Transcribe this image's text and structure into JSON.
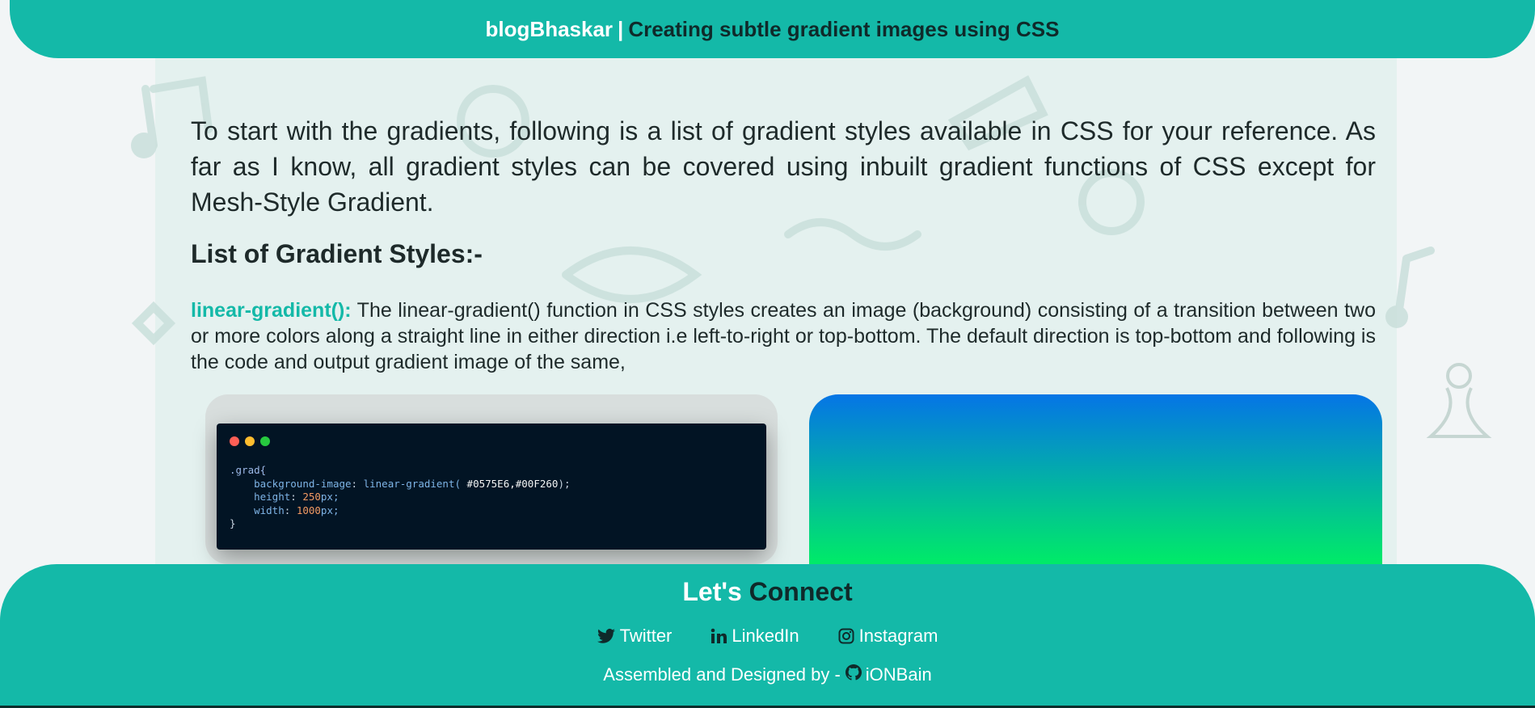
{
  "header": {
    "brand": "blogBhaskar",
    "separator": "|",
    "title": "Creating subtle gradient images using CSS"
  },
  "article": {
    "intro": "To start with the gradients, following is a list of gradient styles available in CSS for your reference. As far as I know, all gradient styles can be covered using inbuilt gradient functions of CSS except for Mesh-Style Gradient.",
    "section_heading": "List of Gradient Styles:-",
    "linear": {
      "term": "linear-gradient():",
      "description": " The linear-gradient() function in CSS styles creates an image (background) consisting of a transition between two or more colors along a straight line in either direction i.e left-to-right or top-bottom. The default direction is top-bottom and following is the code and output gradient image of the same,"
    }
  },
  "code_snippet": {
    "window_dot_colors": [
      "#ff5f56",
      "#ffbd2e",
      "#27c93f"
    ],
    "line1_selector": ".grad{",
    "line2_prop": "background-image",
    "line2_fn": "linear-gradient(",
    "line2_args": " #0575E6,#00F260",
    "line2_end": ");",
    "line3_prop": "height",
    "line3_num": "250",
    "line3_unit": "px;",
    "line4_prop": "width",
    "line4_num": "1000",
    "line4_unit": "px;",
    "line5_close": "}"
  },
  "gradient_output": {
    "from_color": "#0575E6",
    "to_color": "#00F260"
  },
  "footer": {
    "title_word1": "Let's",
    "title_word2": "Connect",
    "links": [
      {
        "label": "Twitter",
        "icon": "twitter-icon"
      },
      {
        "label": "LinkedIn",
        "icon": "linkedin-icon"
      },
      {
        "label": "Instagram",
        "icon": "instagram-icon"
      }
    ],
    "credits_prefix": "Assembled and Designed by -",
    "credits_author": "iONBain",
    "credits_icon": "github-icon"
  },
  "colors": {
    "accent": "#14b9a8",
    "content_bg": "#e4f1ef",
    "page_bg": "#f2f5f6",
    "code_bg": "#021424"
  }
}
